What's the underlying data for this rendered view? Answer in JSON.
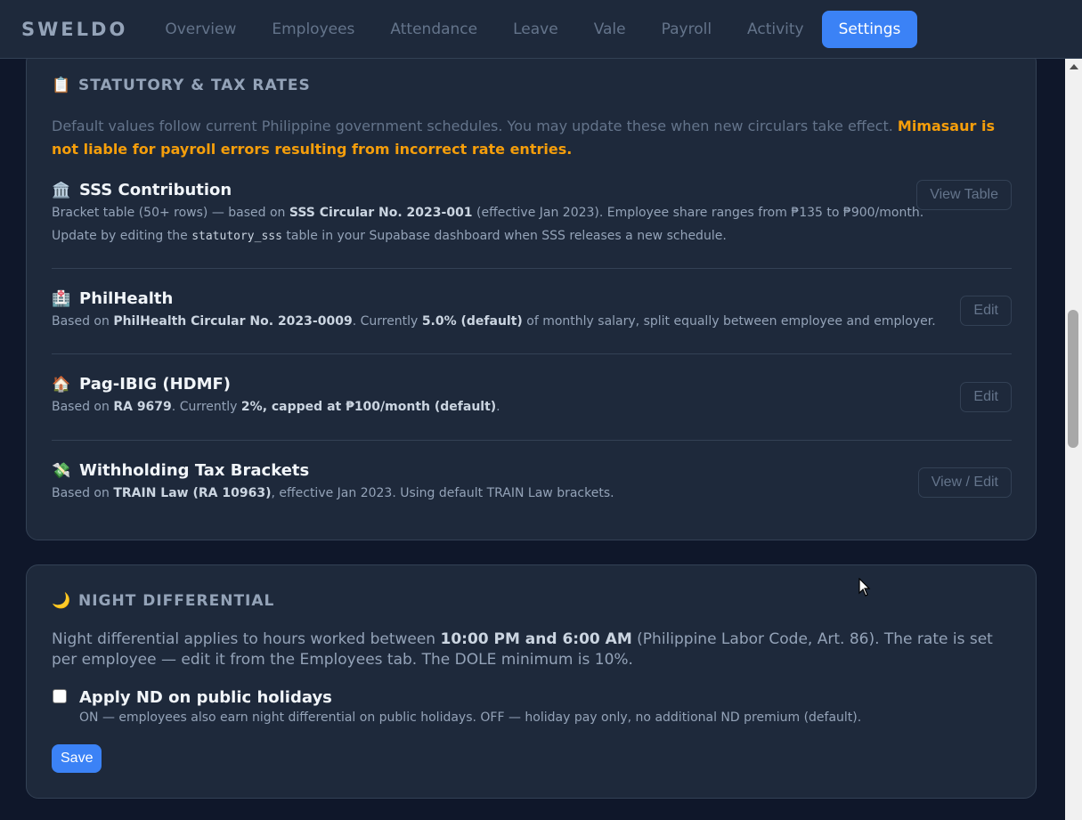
{
  "app": {
    "brand": "SWELDO"
  },
  "nav": {
    "items": [
      {
        "label": "Overview"
      },
      {
        "label": "Employees"
      },
      {
        "label": "Attendance"
      },
      {
        "label": "Leave"
      },
      {
        "label": "Vale"
      },
      {
        "label": "Payroll"
      },
      {
        "label": "Activity"
      },
      {
        "label": "Settings",
        "active": true
      }
    ]
  },
  "statutory": {
    "title_icon": "clipboard-icon",
    "title": "STATUTORY & TAX RATES",
    "intro": "Default values follow current Philippine government schedules. You may update these when new circulars take effect.",
    "warning": "Mimasaur is not liable for payroll errors resulting from incorrect rate entries.",
    "rates": [
      {
        "icon": "bank-icon",
        "name": "SSS Contribution",
        "desc_1": "Bracket table (50+ rows) — based on",
        "desc_bold": "SSS Circular No. 2023-001",
        "desc_2": "(effective Jan 2023). Employee share ranges from ₱135 to ₱900/month.",
        "line2_pre": "Update by editing the",
        "line2_code": "statutory_sss",
        "line2_post": "table in your Supabase dashboard when SSS releases a new schedule.",
        "button": "View Table"
      },
      {
        "icon": "hospital-icon",
        "name": "PhilHealth",
        "desc_1": "Based on",
        "desc_bold": "PhilHealth Circular No. 2023-0009",
        "desc_2": ". Currently",
        "desc_bold2": "5.0% (default)",
        "desc_3": "of monthly salary, split equally between employee and employer.",
        "button": "Edit"
      },
      {
        "icon": "house-icon",
        "name": "Pag-IBIG (HDMF)",
        "desc_1": "Based on",
        "desc_bold": "RA 9679",
        "desc_2": ". Currently",
        "desc_bold2": "2%, capped at ₱100/month (default)",
        "desc_3": ".",
        "button": "Edit"
      },
      {
        "icon": "money-icon",
        "name": "Withholding Tax Brackets",
        "desc_1": "Based on",
        "desc_bold": "TRAIN Law (RA 10963)",
        "desc_2": ", effective Jan 2023. Using default TRAIN Law brackets.",
        "button": "View / Edit"
      }
    ]
  },
  "night_diff": {
    "title_icon": "moon-icon",
    "title": "NIGHT DIFFERENTIAL",
    "text_1": "Night differential applies to hours worked between",
    "text_bold": "10:00 PM and 6:00 AM",
    "text_2": "(Philippine Labor Code, Art. 86). The rate is set per employee — edit it from the Employees tab. The DOLE minimum is 10%.",
    "checkbox_label": "Apply ND on public holidays",
    "checkbox_checked": false,
    "help": "ON — employees also earn night differential on public holidays. OFF — holiday pay only, no additional ND premium (default).",
    "save": "Save"
  }
}
